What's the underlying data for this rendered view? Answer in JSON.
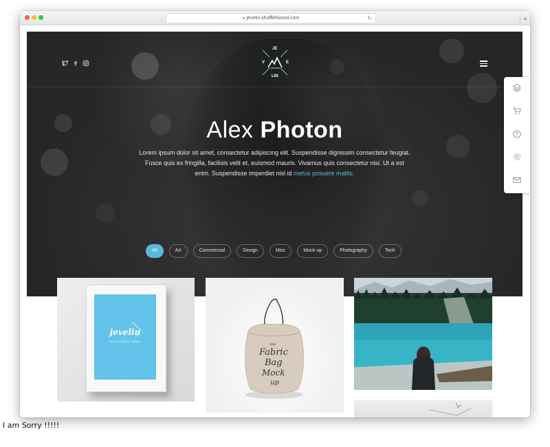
{
  "browser": {
    "url": "jevelin.shufflehound.com"
  },
  "hero": {
    "logo_letters": [
      "JE",
      "V",
      "E",
      "LIN"
    ],
    "title_first": "Alex",
    "title_last": "Photon",
    "description": "Lorem ipsum dolor sit amet, consectetur adipiscing elit. Suspendisse dignissim consectetur feugiat. Fusce quis ex fringilla, facilisis velit et, euismod mauris. Vivamus quis consectetur nisi. Ut a est enim. Suspendisse imperdiet nisl id",
    "description_link": "metus posuere mattis.",
    "social_icons": [
      "twitter-icon",
      "facebook-icon",
      "instagram-icon"
    ]
  },
  "filters": [
    "All",
    "Art",
    "Commercial",
    "Design",
    "Misc",
    "Mock-up",
    "Photography",
    "Tech"
  ],
  "active_filter": "All",
  "side_panel": [
    "layers-icon",
    "cart-icon",
    "help-icon",
    "settings-icon",
    "mail-icon"
  ],
  "portfolio": {
    "frame_title": "jevelin",
    "frame_subtitle": "WORDPRESS THEME",
    "bag_text": [
      "the",
      "Fabric",
      "Bag",
      "Mock",
      "up"
    ]
  },
  "caption": "I am Sorry !!!!!",
  "colors": {
    "accent": "#5ab7dd",
    "hero_bg": "#2f2f2f",
    "frame_blue": "#63c2e9"
  }
}
